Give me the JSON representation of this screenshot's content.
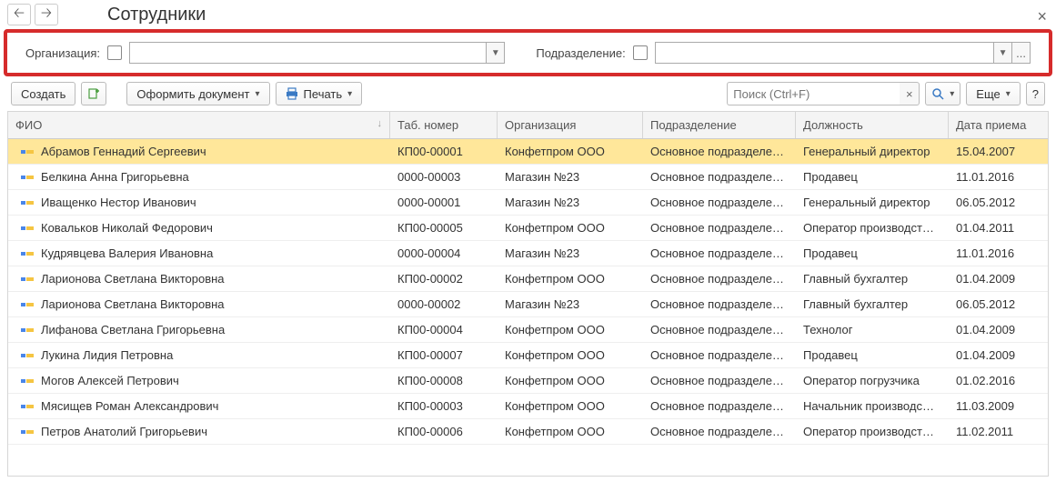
{
  "title": "Сотрудники",
  "filter": {
    "org_label": "Организация:",
    "pod_label": "Подразделение:",
    "ellipsis": "..."
  },
  "toolbar": {
    "create": "Создать",
    "doc": "Оформить документ",
    "print": "Печать",
    "more": "Еще",
    "help": "?",
    "search_placeholder": "Поиск (Ctrl+F)"
  },
  "columns": {
    "fio": "ФИО",
    "tab": "Таб. номер",
    "org": "Организация",
    "pod": "Подразделение",
    "dol": "Должность",
    "date": "Дата приема"
  },
  "rows": [
    {
      "fio": "Абрамов Геннадий Сергеевич",
      "tab": "КП00-00001",
      "org": "Конфетпром ООО",
      "pod": "Основное подразделе…",
      "dol": "Генеральный директор",
      "date": "15.04.2007",
      "selected": true
    },
    {
      "fio": "Белкина Анна Григорьевна",
      "tab": "0000-00003",
      "org": "Магазин №23",
      "pod": "Основное подразделе…",
      "dol": "Продавец",
      "date": "11.01.2016"
    },
    {
      "fio": "Иващенко Нестор Иванович",
      "tab": "0000-00001",
      "org": "Магазин №23",
      "pod": "Основное подразделе…",
      "dol": "Генеральный директор",
      "date": "06.05.2012"
    },
    {
      "fio": "Ковальков Николай Федорович",
      "tab": "КП00-00005",
      "org": "Конфетпром ООО",
      "pod": "Основное подразделе…",
      "dol": "Оператор производст…",
      "date": "01.04.2011"
    },
    {
      "fio": "Кудрявцева Валерия Ивановна",
      "tab": "0000-00004",
      "org": "Магазин №23",
      "pod": "Основное подразделе…",
      "dol": "Продавец",
      "date": "11.01.2016"
    },
    {
      "fio": "Ларионова Светлана Викторовна",
      "tab": "КП00-00002",
      "org": "Конфетпром ООО",
      "pod": "Основное подразделе…",
      "dol": "Главный бухгалтер",
      "date": "01.04.2009"
    },
    {
      "fio": "Ларионова Светлана Викторовна",
      "tab": "0000-00002",
      "org": "Магазин №23",
      "pod": "Основное подразделе…",
      "dol": "Главный бухгалтер",
      "date": "06.05.2012"
    },
    {
      "fio": "Лифанова Светлана Григорьевна",
      "tab": "КП00-00004",
      "org": "Конфетпром ООО",
      "pod": "Основное подразделе…",
      "dol": "Технолог",
      "date": "01.04.2009"
    },
    {
      "fio": "Лукина Лидия Петровна",
      "tab": "КП00-00007",
      "org": "Конфетпром ООО",
      "pod": "Основное подразделе…",
      "dol": "Продавец",
      "date": "01.04.2009"
    },
    {
      "fio": "Могов Алексей Петрович",
      "tab": "КП00-00008",
      "org": "Конфетпром ООО",
      "pod": "Основное подразделе…",
      "dol": "Оператор погрузчика",
      "date": "01.02.2016"
    },
    {
      "fio": "Мясищев Роман Александрович",
      "tab": "КП00-00003",
      "org": "Конфетпром ООО",
      "pod": "Основное подразделе…",
      "dol": "Начальник производс…",
      "date": "11.03.2009"
    },
    {
      "fio": "Петров Анатолий Григорьевич",
      "tab": "КП00-00006",
      "org": "Конфетпром ООО",
      "pod": "Основное подразделе…",
      "dol": "Оператор производст…",
      "date": "11.02.2011"
    }
  ]
}
